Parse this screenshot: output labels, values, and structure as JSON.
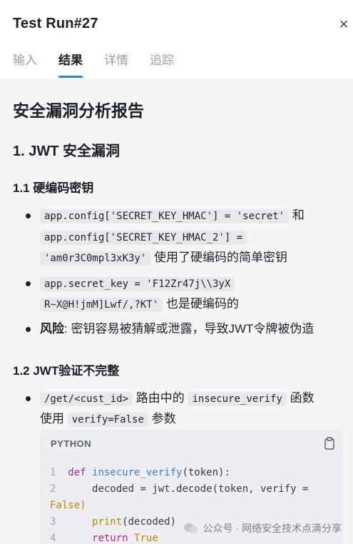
{
  "header": {
    "title": "Test Run#27",
    "close": "×",
    "tabs": [
      {
        "label": "输入",
        "active": false
      },
      {
        "label": "结果",
        "active": true
      },
      {
        "label": "详情",
        "active": false
      },
      {
        "label": "追踪",
        "active": false
      }
    ]
  },
  "report": {
    "title": "安全漏洞分析报告",
    "section1": "1. JWT 安全漏洞",
    "sub11": "1.1 硬编码密钥",
    "b1_code1": "app.config['SECRET_KEY_HMAC'] = 'secret'",
    "b1_text1": "和",
    "b1_code2": "app.config['SECRET_KEY_HMAC_2'] =",
    "b1_code3": "'am0r3C0mpl3xK3y'",
    "b1_text2": "使用了硬编码的简单密钥",
    "b2_code1": "app.secret_key = 'F12Zr47j\\\\3yX",
    "b2_code2": "R~X@H!jmM]Lwf/,?KT'",
    "b2_text": "也是硬编码的",
    "b3_strong": "风险",
    "b3_text": ": 密钥容易被猜解或泄露，导致JWT令牌被伪造",
    "sub12": "1.2 JWT验证不完整",
    "b4_code1": "/get/<cust_id>",
    "b4_text1": "路由中的",
    "b4_code2": "insecure_verify",
    "b4_text2": "函数",
    "b4_text3": "使用",
    "b4_code3": "verify=False",
    "b4_text4": "参数"
  },
  "codeblock": {
    "language": "PYTHON",
    "lines": [
      {
        "n": "1",
        "def": "def ",
        "fn": "insecure_verify",
        "rest": "(token):"
      },
      {
        "n": "2",
        "text": "    decoded = jwt.decode(token, verify ="
      },
      {
        "n": "",
        "text": "False)"
      },
      {
        "n": "3",
        "pre": "    ",
        "call": "print",
        "rest": "(decoded)"
      },
      {
        "n": "4",
        "pre": "    ",
        "kw": "return ",
        "bi": "True"
      }
    ]
  },
  "watermark": "公众号 · 网络安全技术点滴分享"
}
